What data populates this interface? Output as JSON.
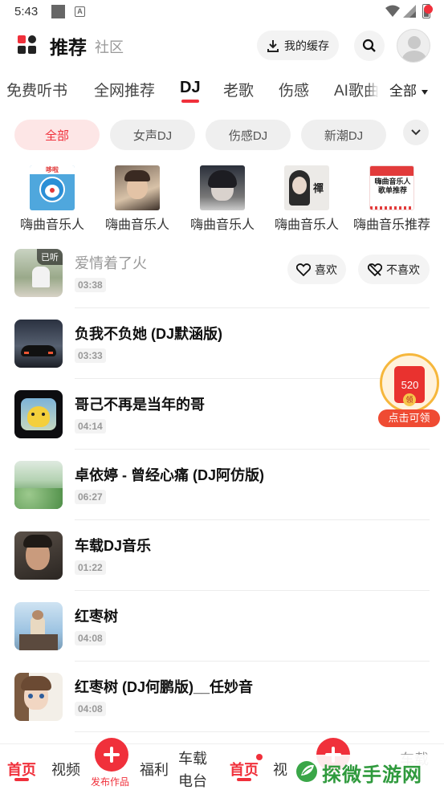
{
  "status_bar": {
    "time": "5:43",
    "a_icon": "A"
  },
  "header": {
    "title": "推荐",
    "subtitle": "社区",
    "cache_label": "我的缓存",
    "icons": {
      "logo": "app-logo-icon",
      "download": "download-icon",
      "search": "search-icon",
      "avatar": "user-avatar-icon"
    },
    "accent": "#f0303b"
  },
  "tabs": {
    "items": [
      "免费听书",
      "全网推荐",
      "DJ",
      "老歌",
      "伤感",
      "AI歌曲"
    ],
    "active": "DJ",
    "all_label": "全部"
  },
  "chips": {
    "items": [
      "全部",
      "女声DJ",
      "伤感DJ",
      "新潮DJ"
    ],
    "active": "全部"
  },
  "playlists": [
    {
      "label": "嗨曲音乐人",
      "cover_text": "哆啦"
    },
    {
      "label": "嗨曲音乐人"
    },
    {
      "label": "嗨曲音乐人"
    },
    {
      "label": "嗨曲音乐人",
      "cover_text": "禪"
    },
    {
      "label": "嗨曲音乐推荐",
      "cover_text": "嗨曲音乐人 歌单推荐"
    }
  ],
  "songs": [
    {
      "title": "爱情着了火",
      "duration": "03:38",
      "played": true,
      "badge": "已听",
      "like_label": "喜欢",
      "dislike_label": "不喜欢"
    },
    {
      "title": "负我不负她 (DJ默涵版)",
      "duration": "03:33"
    },
    {
      "title": "哥己不再是当年的哥",
      "duration": "04:14"
    },
    {
      "title": "卓依婷 - 曾经心痛 (DJ阿仿版)",
      "duration": "06:27"
    },
    {
      "title": "车载DJ音乐",
      "duration": "01:22"
    },
    {
      "title": "红枣树",
      "duration": "04:08"
    },
    {
      "title": "红枣树 (DJ何鹏版)__任妙音",
      "duration": "04:08"
    }
  ],
  "red_packet": {
    "amount": "520",
    "coin": "领",
    "cta": "点击可领"
  },
  "bottom_nav": {
    "home": "首页",
    "video": "视频",
    "publish": "发布作品",
    "welfare": "福利",
    "car_radio_1": "车载",
    "car_radio_2": "电台",
    "home2": "首页",
    "video2_partial": "视",
    "right_partial": "车载"
  },
  "watermark": {
    "text": "探微手游网"
  }
}
